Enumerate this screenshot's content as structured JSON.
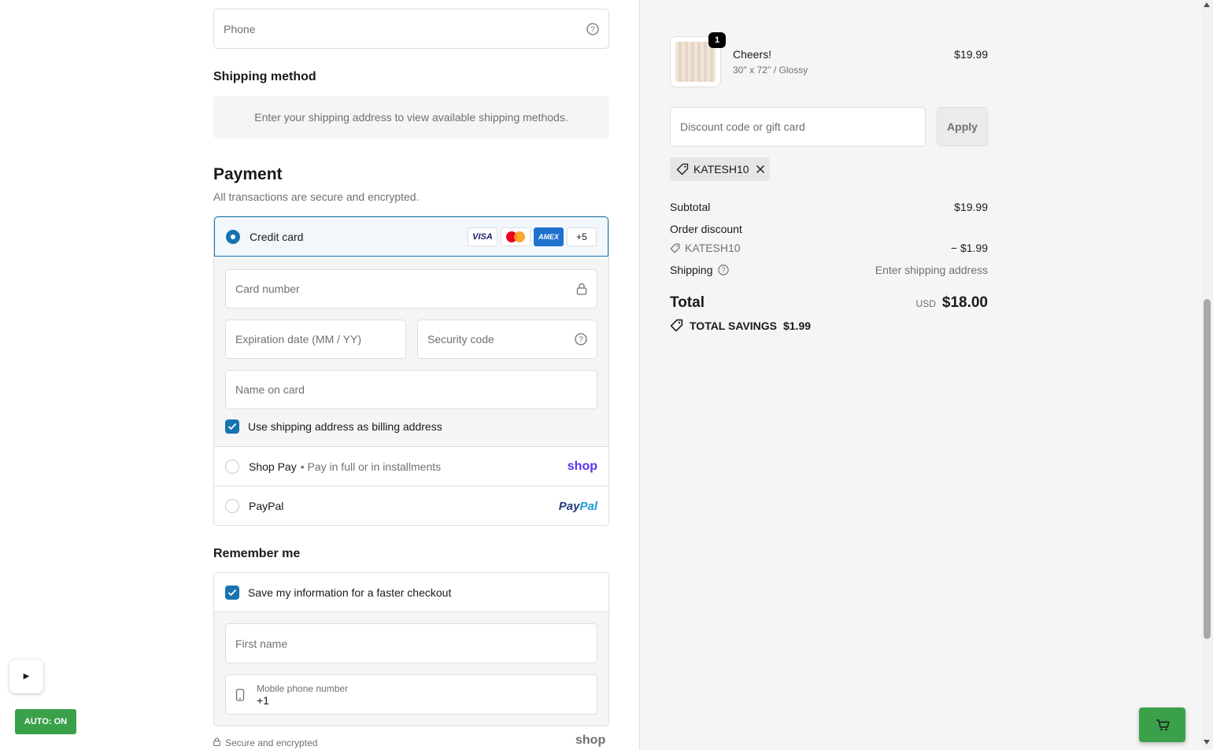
{
  "contact": {
    "phone_placeholder": "Phone"
  },
  "shipping": {
    "heading": "Shipping method",
    "notice": "Enter your shipping address to view available shipping methods."
  },
  "payment": {
    "heading": "Payment",
    "subheading": "All transactions are secure and encrypted.",
    "credit_card_label": "Credit card",
    "card_brands": [
      "VISA",
      "AMEX"
    ],
    "more_cards": "+5",
    "card_number_placeholder": "Card number",
    "expiration_placeholder": "Expiration date (MM / YY)",
    "security_code_placeholder": "Security code",
    "name_on_card_placeholder": "Name on card",
    "billing_same_label": "Use shipping address as billing address",
    "billing_same_checked": true,
    "shop_pay_label": "Shop Pay",
    "shop_pay_sub": "• Pay in full or in installments",
    "shop_logo": "shop",
    "paypal_label": "PayPal",
    "paypal_logo_a": "Pay",
    "paypal_logo_b": "Pal",
    "selected": "credit-card"
  },
  "remember": {
    "heading": "Remember me",
    "save_label": "Save my information for a faster checkout",
    "save_checked": true,
    "first_name_placeholder": "First name",
    "mobile_label": "Mobile phone number",
    "mobile_prefix": "+1"
  },
  "footer": {
    "secure_text": "Secure and encrypted",
    "shop_logo": "shop"
  },
  "widgets": {
    "play_glyph": "▶",
    "auto_label": "AUTO: ON"
  },
  "order": {
    "item": {
      "quantity": "1",
      "name": "Cheers!",
      "variant": "30'' x 72'' / Glossy",
      "price": "$19.99"
    },
    "discount_placeholder": "Discount code or gift card",
    "apply_label": "Apply",
    "applied_code": "KATESH10",
    "subtotal_label": "Subtotal",
    "subtotal_value": "$19.99",
    "order_discount_label": "Order discount",
    "discount_code": "KATESH10",
    "discount_value": "− $1.99",
    "shipping_label": "Shipping",
    "shipping_value": "Enter shipping address",
    "total_label": "Total",
    "currency": "USD",
    "total_value": "$18.00",
    "savings_label": "TOTAL SAVINGS",
    "savings_value": "$1.99"
  },
  "colors": {
    "accent": "#1773b0",
    "shop_purple": "#5a31f4",
    "widget_green": "#3aa14a"
  }
}
